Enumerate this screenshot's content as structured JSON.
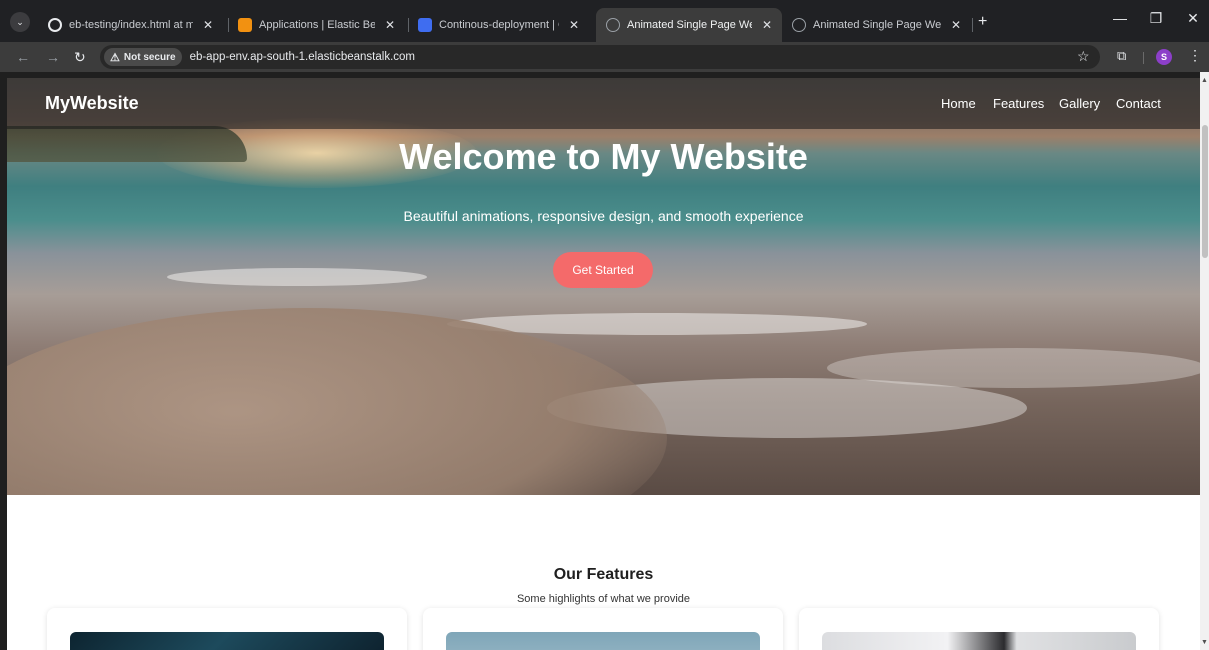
{
  "browser": {
    "tabs": [
      {
        "title": "eb-testing/index.html at main",
        "icon": "github-icon"
      },
      {
        "title": "Applications | Elastic Beanstalk",
        "icon": "aws-icon"
      },
      {
        "title": "Continous-deployment | CodeP",
        "icon": "codepipeline-icon"
      },
      {
        "title": "Animated Single Page Website",
        "icon": "globe-icon",
        "active": true
      },
      {
        "title": "Animated Single Page Website",
        "icon": "globe-icon"
      }
    ],
    "security_label": "Not secure",
    "url": "eb-app-env.ap-south-1.elasticbeanstalk.com",
    "profile_initial": "S"
  },
  "site": {
    "logo": "MyWebsite",
    "nav": [
      "Home",
      "Features",
      "Gallery",
      "Contact"
    ],
    "hero": {
      "title": "Welcome to My Website",
      "subtitle": "Beautiful animations, responsive design, and smooth experience",
      "cta": "Get Started"
    },
    "features": {
      "title": "Our Features",
      "subtitle": "Some highlights of what we provide"
    }
  },
  "colors": {
    "cta": "#f46a6a",
    "tab_bar": "#202124",
    "toolbar": "#3c3c3c"
  }
}
